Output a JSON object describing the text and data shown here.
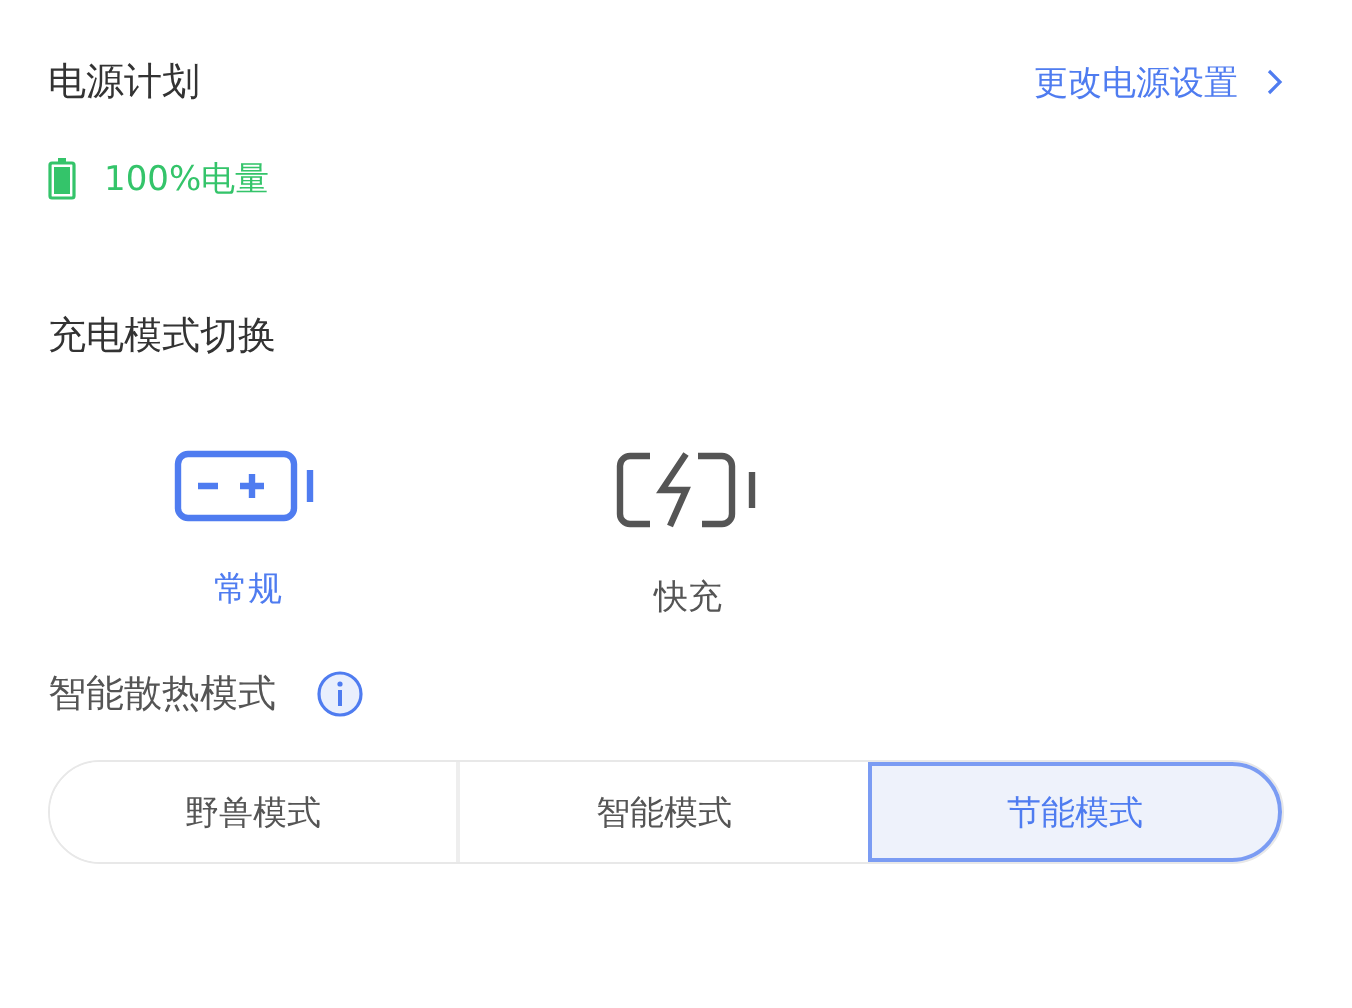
{
  "power_plan": {
    "title": "电源计划",
    "link": "更改电源设置",
    "battery": {
      "label": "100%电量"
    }
  },
  "charge_mode": {
    "title": "充电模式切换",
    "modes": [
      {
        "kind": "normal",
        "label": "常规",
        "selected": true
      },
      {
        "kind": "fast",
        "label": "快充",
        "selected": false
      }
    ]
  },
  "cooling": {
    "title": "智能散热模式",
    "options": [
      {
        "label": "野兽模式",
        "selected": false
      },
      {
        "label": "智能模式",
        "selected": false
      },
      {
        "label": "节能模式",
        "selected": true
      }
    ]
  }
}
